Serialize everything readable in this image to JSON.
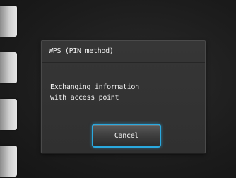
{
  "dialog": {
    "title": "WPS (PIN method)",
    "message": "Exchanging information\nwith access point",
    "cancel_label": "Cancel"
  },
  "colors": {
    "background": "#1c1c1c",
    "dialog_background": "#333333",
    "button_highlight": "#2aa9df",
    "text": "#f2f2f2"
  }
}
